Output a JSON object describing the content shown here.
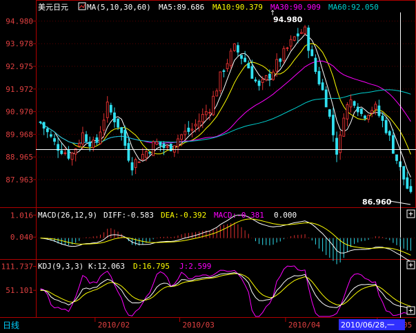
{
  "window": {
    "period_label": "日线",
    "cursor_date": "2010/06/28,一"
  },
  "colors": {
    "up": "#e03030",
    "down": "#30e0f0",
    "ma5": "#ffffff",
    "ma10": "#ffff00",
    "ma30": "#ff00ff",
    "ma60": "#00d0d0",
    "axis": "#b00000",
    "text_red": "#ff3030",
    "diff": "#ffffff",
    "dea": "#ffff00",
    "macd": "#ff00ff",
    "k": "#ffffff",
    "d": "#ffff00",
    "j": "#ff00ff",
    "cursor_date_bg": "#3030ff"
  },
  "header": {
    "symbol": "美元日元",
    "ma_label": "MA(5,10,30,60)",
    "ma5": "MA5:89.686",
    "ma10": "MA10:90.379",
    "ma30": "MA30:90.909",
    "ma60": "MA60:92.050"
  },
  "macd_header": {
    "label": "MACD(26,12,9)",
    "diff": "DIFF:-0.583",
    "dea": "DEA:-0.392",
    "macd": "MACD:-0.381",
    "extra": "0.000"
  },
  "kdj_header": {
    "label": "KDJ(9,3,3)",
    "k": "K:12.063",
    "d": "D:16.795",
    "j": "J:2.599"
  },
  "chart_data": [
    {
      "type": "candlestick",
      "title": "美元日元",
      "y_ticks": [
        "94.980",
        "93.978",
        "92.975",
        "91.972",
        "90.970",
        "89.968",
        "88.965",
        "87.963"
      ],
      "ylim": [
        86.8,
        95.3
      ],
      "annotations": [
        {
          "text": "94.980",
          "value": 94.98,
          "kind": "high"
        },
        {
          "text": "86.960",
          "value": 86.96,
          "kind": "low"
        }
      ],
      "x_ticks": [
        "2010/02",
        "2010/03",
        "2010/04",
        "2010/05"
      ],
      "n_bars": 106
    },
    {
      "type": "bar",
      "title": "MACD(26,12,9)",
      "y_ticks": [
        "1.016",
        "0.040"
      ],
      "ylim": [
        -0.9,
        1.3
      ]
    },
    {
      "type": "line",
      "title": "KDJ(9,3,3)",
      "y_ticks": [
        "111.737",
        "51.101"
      ],
      "ylim": [
        -15,
        125
      ]
    }
  ]
}
